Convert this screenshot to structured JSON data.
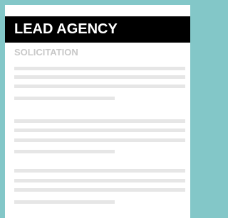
{
  "card": {
    "title": "LEAD AGENCY",
    "subtitle": "SOLICITATION"
  },
  "colors": {
    "background": "#83c7c8",
    "card": "#ffffff",
    "header_bg": "#000000",
    "header_text": "#ffffff",
    "subtitle_text": "#c8c8c8",
    "placeholder_line": "#e6e6e6"
  }
}
